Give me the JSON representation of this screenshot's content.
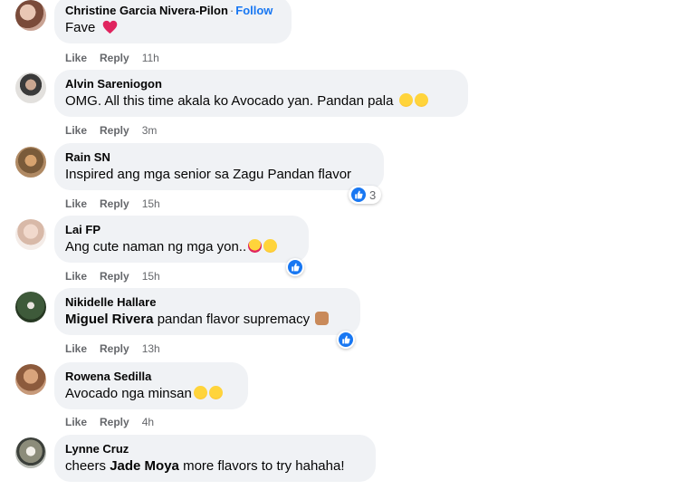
{
  "comments": [
    {
      "author": "Christine Garcia Nivera-Pilon",
      "follow": "Follow",
      "text": "Fave",
      "like": "Like",
      "reply": "Reply",
      "time": "11h"
    },
    {
      "author": "Alvin Sareniogon",
      "text": "OMG. All this time akala ko Avocado yan. Pandan pala",
      "like": "Like",
      "reply": "Reply",
      "time": "3m"
    },
    {
      "author": "Rain SN",
      "text": "Inspired ang mga senior sa Zagu Pandan flavor",
      "like": "Like",
      "reply": "Reply",
      "time": "15h",
      "reaction_count": "3"
    },
    {
      "author": "Lai FP",
      "text": "Ang cute naman ng mga yon..",
      "like": "Like",
      "reply": "Reply",
      "time": "15h"
    },
    {
      "author": "Nikidelle Hallare",
      "mention": "Miguel Rivera",
      "text": " pandan flavor supremacy",
      "like": "Like",
      "reply": "Reply",
      "time": "13h"
    },
    {
      "author": "Rowena Sedilla",
      "text": "Avocado nga minsan",
      "like": "Like",
      "reply": "Reply",
      "time": "4h"
    },
    {
      "author": "Lynne Cruz",
      "text_before": "cheers ",
      "mention": "Jade Moya",
      "text_after": " more flavors to try hahaha!"
    }
  ],
  "colors": {
    "bubble": "#f0f2f5",
    "link": "#1877f2",
    "meta": "#65676b"
  }
}
